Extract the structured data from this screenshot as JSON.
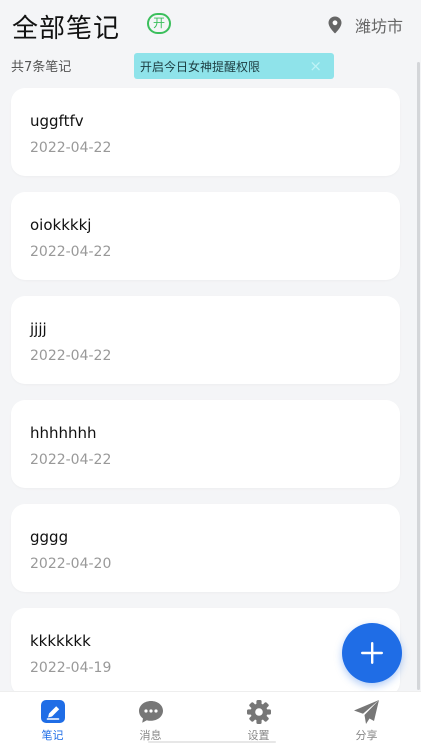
{
  "header": {
    "title": "全部笔记",
    "open_badge": "开",
    "location": "潍坊市"
  },
  "note_count": "共7条笔记",
  "tip": {
    "text": "开启今日女神提醒权限",
    "close": "×"
  },
  "notes": [
    {
      "title": "uggftfv",
      "date": "2022-04-22"
    },
    {
      "title": "oiokkkkj",
      "date": "2022-04-22"
    },
    {
      "title": "jjjj",
      "date": "2022-04-22"
    },
    {
      "title": "hhhhhhh",
      "date": "2022-04-22"
    },
    {
      "title": "gggg",
      "date": "2022-04-20"
    },
    {
      "title": "kkkkkkk",
      "date": "2022-04-19"
    }
  ],
  "tabs": [
    {
      "label": "笔记",
      "icon": "pencil-icon",
      "active": true
    },
    {
      "label": "消息",
      "icon": "chat-bubble-icon",
      "active": false
    },
    {
      "label": "设置",
      "icon": "gear-icon",
      "active": false
    },
    {
      "label": "分享",
      "icon": "paper-plane-icon",
      "active": false
    }
  ],
  "colors": {
    "accent": "#1f6de6",
    "badge_green": "#3bbf5c",
    "tip_bg": "#8fe3ea",
    "icon_gray": "#777777"
  }
}
